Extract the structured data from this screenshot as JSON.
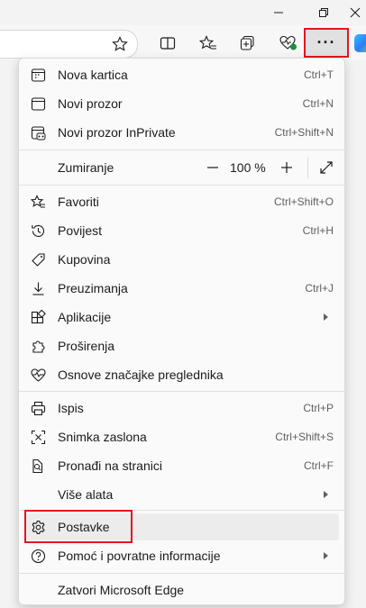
{
  "menu": {
    "new_tab": {
      "label": "Nova kartica",
      "shortcut": "Ctrl+T"
    },
    "new_window": {
      "label": "Novi prozor",
      "shortcut": "Ctrl+N"
    },
    "inprivate": {
      "label": "Novi prozor InPrivate",
      "shortcut": "Ctrl+Shift+N"
    },
    "zoom": {
      "label": "Zumiranje",
      "value": "100 %",
      "minus": "—",
      "plus": "+"
    },
    "favorites": {
      "label": "Favoriti",
      "shortcut": "Ctrl+Shift+O"
    },
    "history": {
      "label": "Povijest",
      "shortcut": "Ctrl+H"
    },
    "shopping": {
      "label": "Kupovina"
    },
    "downloads": {
      "label": "Preuzimanja",
      "shortcut": "Ctrl+J"
    },
    "apps": {
      "label": "Aplikacije"
    },
    "extensions": {
      "label": "Proširenja"
    },
    "essentials": {
      "label": "Osnove značajke preglednika"
    },
    "print": {
      "label": "Ispis",
      "shortcut": "Ctrl+P"
    },
    "screenshot": {
      "label": "Snimka zaslona",
      "shortcut": "Ctrl+Shift+S"
    },
    "find": {
      "label": "Pronađi na stranici",
      "shortcut": "Ctrl+F"
    },
    "more_tools": {
      "label": "Više alata"
    },
    "settings": {
      "label": "Postavke"
    },
    "help": {
      "label": "Pomoć i povratne informacije"
    },
    "close": {
      "label": "Zatvori Microsoft Edge"
    }
  },
  "toolbar": {
    "more_label": "···"
  },
  "colors": {
    "highlight": "#e5141e",
    "menu_bg": "#fafafa"
  }
}
